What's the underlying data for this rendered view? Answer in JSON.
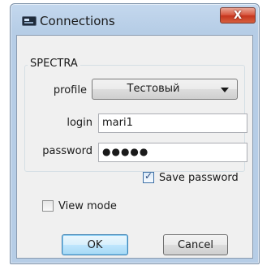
{
  "window": {
    "title": "Connections",
    "close_label": "X"
  },
  "group": {
    "title": "SPECTRA"
  },
  "profile": {
    "label": "profile",
    "value": "Тестовый"
  },
  "login": {
    "label": "login",
    "value": "mari1"
  },
  "password": {
    "label": "password",
    "masked_value": "●●●●●"
  },
  "save_password": {
    "label": "Save password",
    "checked": true
  },
  "view_mode": {
    "label": "View mode",
    "checked": false
  },
  "buttons": {
    "ok": "OK",
    "cancel": "Cancel"
  },
  "icons": {
    "app": "window-icon",
    "close": "close-icon",
    "combo": "chevron-down-icon",
    "check": "checkmark-icon"
  },
  "colors": {
    "close_button": "#c5341d",
    "title_bar": "#b6cde6",
    "dialog_bg": "#f0f0f0",
    "default_button": "#bee6fd"
  }
}
